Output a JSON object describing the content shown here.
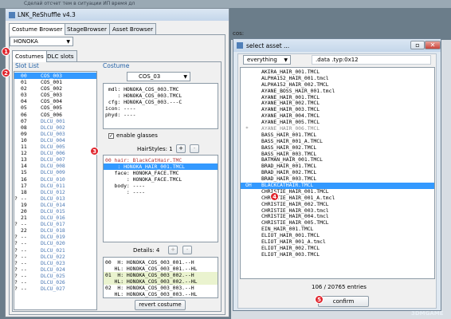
{
  "background_bar": {
    "text": "Сделай отсчет тем в ситуации ИП время дл"
  },
  "main_window": {
    "title": "LNK_ReShuffle v4.3",
    "tabs": [
      "Costume Browser",
      "StageBrowser",
      "Asset Browser"
    ],
    "character": "HONOKA",
    "subtabs": [
      "Costumes",
      "DLC slots"
    ],
    "slot_list_label": "Slot List",
    "slots": [
      {
        "mark": "",
        "num": "00",
        "name": "COS_003",
        "sel": true
      },
      {
        "mark": "",
        "num": "01",
        "name": "COS_001"
      },
      {
        "mark": "",
        "num": "02",
        "name": "COS_002"
      },
      {
        "mark": "",
        "num": "03",
        "name": "COS_003"
      },
      {
        "mark": "",
        "num": "04",
        "name": "COS_004"
      },
      {
        "mark": "",
        "num": "05",
        "name": "COS_005"
      },
      {
        "mark": "",
        "num": "06",
        "name": "COS_006"
      },
      {
        "mark": "",
        "num": "07",
        "name": "DLCU_001",
        "blue": true
      },
      {
        "mark": "",
        "num": "08",
        "name": "DLCU_002",
        "blue": true
      },
      {
        "mark": "",
        "num": "09",
        "name": "DLCU_003",
        "blue": true
      },
      {
        "mark": "",
        "num": "10",
        "name": "DLCU_004",
        "blue": true
      },
      {
        "mark": "",
        "num": "11",
        "name": "DLCU_005",
        "blue": true
      },
      {
        "mark": "",
        "num": "12",
        "name": "DLCU_006",
        "blue": true
      },
      {
        "mark": "",
        "num": "13",
        "name": "DLCU_007",
        "blue": true
      },
      {
        "mark": "",
        "num": "14",
        "name": "DLCU_008",
        "blue": true
      },
      {
        "mark": "",
        "num": "15",
        "name": "DLCU_009",
        "blue": true
      },
      {
        "mark": "",
        "num": "16",
        "name": "DLCU_010",
        "blue": true
      },
      {
        "mark": "",
        "num": "17",
        "name": "DLCU_011",
        "blue": true
      },
      {
        "mark": "",
        "num": "18",
        "name": "DLCU_012",
        "blue": true
      },
      {
        "mark": "?",
        "num": "--",
        "name": "DLCU_013",
        "blue": true
      },
      {
        "mark": "",
        "num": "19",
        "name": "DLCU_014",
        "blue": true
      },
      {
        "mark": "",
        "num": "20",
        "name": "DLCU_015",
        "blue": true
      },
      {
        "mark": "",
        "num": "21",
        "name": "DLCU_016",
        "blue": true
      },
      {
        "mark": "?",
        "num": "--",
        "name": "DLCU_017",
        "blue": true
      },
      {
        "mark": "",
        "num": "22",
        "name": "DLCU_018",
        "blue": true
      },
      {
        "mark": "?",
        "num": "--",
        "name": "DLCU_019",
        "blue": true
      },
      {
        "mark": "?",
        "num": "--",
        "name": "DLCU_020",
        "blue": true
      },
      {
        "mark": "?",
        "num": "--",
        "name": "DLCU_021",
        "blue": true
      },
      {
        "mark": "?",
        "num": "--",
        "name": "DLCU_022",
        "blue": true
      },
      {
        "mark": "?",
        "num": "--",
        "name": "DLCU_023",
        "blue": true
      },
      {
        "mark": "?",
        "num": "--",
        "name": "DLCU_024",
        "blue": true
      },
      {
        "mark": "?",
        "num": "--",
        "name": "DLCU_025",
        "blue": true
      },
      {
        "mark": "?",
        "num": "--",
        "name": "DLCU_026",
        "blue": true
      },
      {
        "mark": "?",
        "num": "--",
        "name": "DLCU_027",
        "blue": true
      }
    ],
    "costume_label": "Costume",
    "costume_select": "COS_03",
    "costume_info": [
      " mdl: HONOKA_COS_003.TMC",
      "    : HONOKA_COS_003.TMCL",
      " cfg: HONOKA_COS_003.---C",
      "icon: ----",
      "phyd: ----"
    ],
    "enable_glasses": "enable glasses",
    "hairstyles_label": "HairStyles: 1",
    "plus": "+",
    "minus": "-",
    "hair_lines": [
      {
        "text": "00 hair: BlackCatHair.TMC",
        "cls": "hl1"
      },
      {
        "text": "    : HONOKA_HAIR_001.TMCL",
        "cls": "sel"
      },
      {
        "text": "   face: HONOKA_FACE.TMC",
        "cls": ""
      },
      {
        "text": "       : HONOKA_FACE.TMCL",
        "cls": ""
      },
      {
        "text": "   body: ----",
        "cls": ""
      },
      {
        "text": "       : ----",
        "cls": ""
      }
    ],
    "details_label": "Details: 4",
    "detail_lines": [
      {
        "text": "00  H: HONOKA_COS_003_001.--H",
        "hl": false
      },
      {
        "text": "   HL: HONOKA_COS_003_001.--HL",
        "hl": false
      },
      {
        "text": "01  H: HONOKA_COS_003_002.--H",
        "hl": true
      },
      {
        "text": "   HL: HONOKA_COS_003_002.--HL",
        "hl": true
      },
      {
        "text": "02  H: HONOKA_COS_003_003.--H",
        "hl": false
      },
      {
        "text": "   HL: HONOKA_COS_003_003.--HL",
        "hl": false
      }
    ],
    "revert_button": "revert costume",
    "cut_label": "cos:"
  },
  "dialog": {
    "title": "select asset ...",
    "filter": "everything",
    "search": ".data .typ:0x12",
    "assets": [
      {
        "p": "",
        "t": "AKIRA_HAIR_001.TMCL"
      },
      {
        "p": "",
        "t": "ALPHA152_HAIR_001.tmcl"
      },
      {
        "p": "",
        "t": "ALPHA152_HAIR_002.TMCL"
      },
      {
        "p": "",
        "t": "AYANE_BOSS_HAIR_001.tmcl"
      },
      {
        "p": "",
        "t": "AYANE_HAIR_001.TMCL"
      },
      {
        "p": "",
        "t": "AYANE_HAIR_002.TMCL"
      },
      {
        "p": "",
        "t": "AYANE_HAIR_003.TMCL"
      },
      {
        "p": "",
        "t": "AYANE_HAIR_004.TMCL"
      },
      {
        "p": "",
        "t": "AYANE_HAIR_005.TMCL"
      },
      {
        "p": "*",
        "t": "AYANE_HAIR_006.TMCL",
        "gray": true
      },
      {
        "p": "",
        "t": "BASS_HAIR_001.TMCL"
      },
      {
        "p": "",
        "t": "BASS_HAIR_001_A.TMCL"
      },
      {
        "p": "",
        "t": "BASS_HAIR_002.TMCL"
      },
      {
        "p": "",
        "t": "BASS_HAIR_003.TMCL"
      },
      {
        "p": "",
        "t": "BATMAN_HAIR_001.TMCL"
      },
      {
        "p": "",
        "t": "BRAD_HAIR_001.TMCL"
      },
      {
        "p": "",
        "t": "BRAD_HAIR_002.TMCL"
      },
      {
        "p": "",
        "t": "BRAD_HAIR_003.TMCL"
      },
      {
        "p": "OH",
        "t": "BLACKCATHAIR.TMCL",
        "sel": true
      },
      {
        "p": "",
        "t": "CHRISTIE_HAIR_001.TMCL"
      },
      {
        "p": "",
        "t": "CHRISTIE_HAIR_001_A.tmcl"
      },
      {
        "p": "",
        "t": "CHRISTIE_HAIR_002.TMCL"
      },
      {
        "p": "",
        "t": "CHRISTIE_HAIR_003.tmcl"
      },
      {
        "p": "",
        "t": "CHRISTIE_HAIR_004.tmcl"
      },
      {
        "p": "",
        "t": "CHRISTIE_HAIR_005.TMCL"
      },
      {
        "p": "",
        "t": "EIN_HAIR_001.TMCL"
      },
      {
        "p": "",
        "t": "ELIOT_HAIR_001.TMCL"
      },
      {
        "p": "",
        "t": "ELIOT_HAIR_001_A.tmcl"
      },
      {
        "p": "",
        "t": "ELIOT_HAIR_002.TMCL"
      },
      {
        "p": "",
        "t": "ELIOT_HAIR_003.TMCL"
      }
    ],
    "count": "106 / 20765 entries",
    "confirm": "confirm"
  },
  "badges": [
    "1",
    "2",
    "3",
    "4",
    "5"
  ],
  "watermark": "3DMGAME",
  "colors": {
    "selection": "#3399ff",
    "badge": "#e0242c",
    "group_label": "#1f5fa6",
    "dlc_text": "#4a78b4"
  }
}
